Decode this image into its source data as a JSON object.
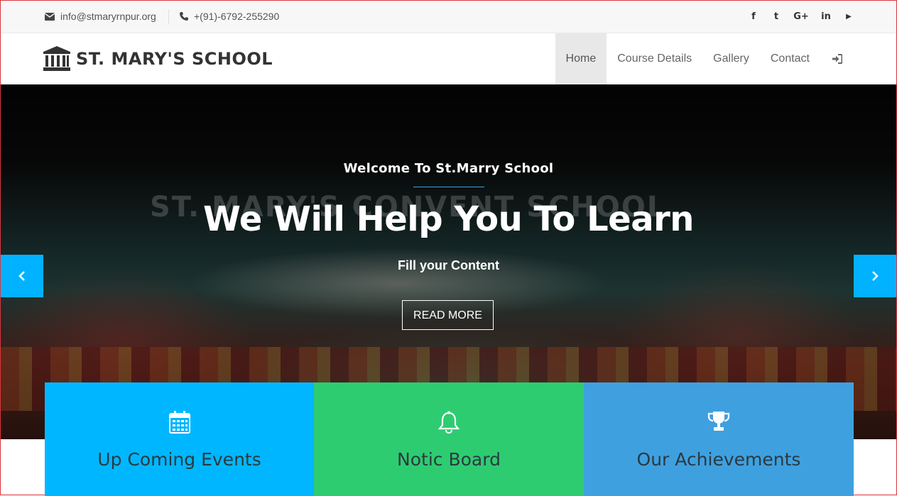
{
  "topbar": {
    "email": "info@stmaryrnpur.org",
    "phone": "+(91)-6792-255290",
    "social": [
      {
        "icon": "facebook-icon",
        "glyph": "f"
      },
      {
        "icon": "twitter-icon",
        "glyph": "t"
      },
      {
        "icon": "google-plus-icon",
        "glyph": "G+"
      },
      {
        "icon": "linkedin-icon",
        "glyph": "in"
      },
      {
        "icon": "youtube-icon",
        "glyph": "▶"
      }
    ]
  },
  "navbar": {
    "logo_text": "ST. MARY'S SCHOOL",
    "items": [
      "Home",
      "Course Details",
      "Gallery",
      "Contact"
    ],
    "active": "Home",
    "login_icon": "sign-in-icon"
  },
  "hero": {
    "subtitle": "Welcome To St.Marry School",
    "title": "We Will Help You To Learn",
    "description": "Fill your Content",
    "button": "READ MORE",
    "banner_text": "ST. MARY'S CONVENT SCHOOL",
    "prev_icon": "chevron-left-icon",
    "next_icon": "chevron-right-icon",
    "accent": "#00b2ff"
  },
  "features": [
    {
      "title": "Up Coming Events",
      "icon": "calendar-icon",
      "color": "#00b7ff"
    },
    {
      "title": "Notic Board",
      "icon": "bell-icon",
      "color": "#2ecc71"
    },
    {
      "title": "Our Achievements",
      "icon": "trophy-icon",
      "color": "#3fa0e0"
    }
  ]
}
